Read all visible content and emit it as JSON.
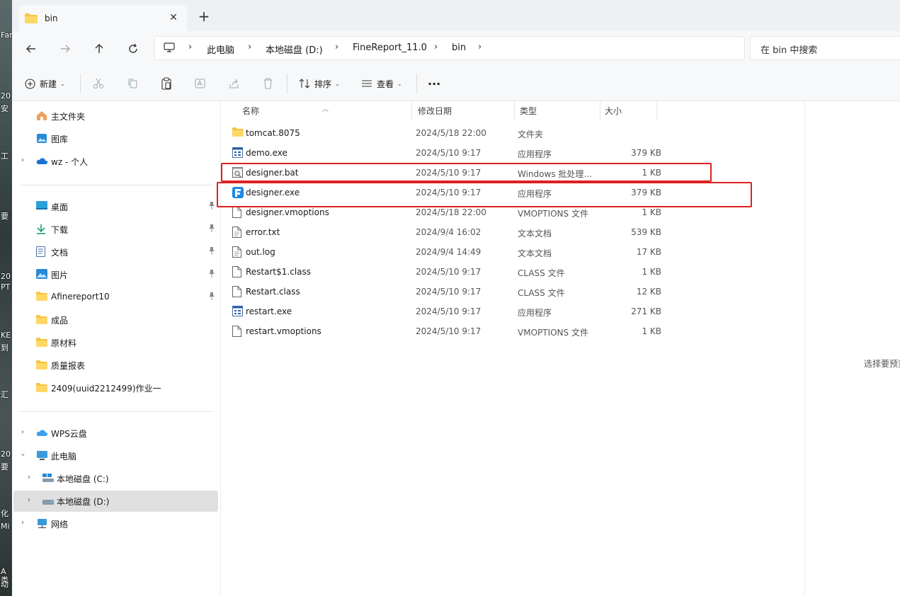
{
  "tab": {
    "title": "bin",
    "close": "✕",
    "new": "+"
  },
  "breadcrumb": [
    "此电脑",
    "本地磁盘 (D:)",
    "FineReport_11.0",
    "bin"
  ],
  "search": {
    "placeholder": "在 bin 中搜索"
  },
  "toolbar": {
    "new_label": "新建",
    "sort_label": "排序",
    "view_label": "查看",
    "more_label": "···"
  },
  "sidebar": {
    "home": "主文件夹",
    "gallery": "图库",
    "personal": "wz - 个人",
    "pinned": [
      {
        "label": "桌面",
        "icon": "desktop"
      },
      {
        "label": "下载",
        "icon": "download"
      },
      {
        "label": "文档",
        "icon": "document"
      },
      {
        "label": "图片",
        "icon": "pictures"
      },
      {
        "label": "Afinereport10",
        "icon": "folder"
      }
    ],
    "folders": [
      "成品",
      "原材料",
      "质量报表",
      "2409(uuid2212499)作业一"
    ],
    "wps": "WPS云盘",
    "this_pc": "此电脑",
    "drive_c": "本地磁盘 (C:)",
    "drive_d": "本地磁盘 (D:)",
    "network": "网络"
  },
  "columns": {
    "name": "名称",
    "date": "修改日期",
    "type": "类型",
    "size": "大小"
  },
  "files": [
    {
      "name": "tomcat.8075",
      "date": "2024/5/18 22:00",
      "type": "文件夹",
      "size": "",
      "icon": "folder"
    },
    {
      "name": "demo.exe",
      "date": "2024/5/10 9:17",
      "type": "应用程序",
      "size": "379 KB",
      "icon": "app"
    },
    {
      "name": "designer.bat",
      "date": "2024/5/10 9:17",
      "type": "Windows 批处理...",
      "size": "1 KB",
      "icon": "bat"
    },
    {
      "name": "designer.exe",
      "date": "2024/5/10 9:17",
      "type": "应用程序",
      "size": "379 KB",
      "icon": "finereport"
    },
    {
      "name": "designer.vmoptions",
      "date": "2024/5/18 22:00",
      "type": "VMOPTIONS 文件",
      "size": "1 KB",
      "icon": "file"
    },
    {
      "name": "error.txt",
      "date": "2024/9/4 16:02",
      "type": "文本文档",
      "size": "539 KB",
      "icon": "text"
    },
    {
      "name": "out.log",
      "date": "2024/9/4 14:49",
      "type": "文本文档",
      "size": "17 KB",
      "icon": "text"
    },
    {
      "name": "Restart$1.class",
      "date": "2024/5/10 9:17",
      "type": "CLASS 文件",
      "size": "1 KB",
      "icon": "file"
    },
    {
      "name": "Restart.class",
      "date": "2024/5/10 9:17",
      "type": "CLASS 文件",
      "size": "12 KB",
      "icon": "file"
    },
    {
      "name": "restart.exe",
      "date": "2024/5/10 9:17",
      "type": "应用程序",
      "size": "271 KB",
      "icon": "app"
    },
    {
      "name": "restart.vmoptions",
      "date": "2024/5/10 9:17",
      "type": "VMOPTIONS 文件",
      "size": "1 KB",
      "icon": "file"
    }
  ],
  "details_hint": "选择要预览",
  "desktop_fragments": [
    "Far",
    "20",
    "安",
    "工",
    "要",
    "20",
    "PT",
    "KE",
    "到",
    "汇",
    "20",
    "要",
    "化",
    "Mi",
    "A类",
    "动"
  ],
  "colors": {
    "highlight": "#e02020",
    "selected_bg": "#e0e0e0",
    "folder": "#f6c342"
  }
}
